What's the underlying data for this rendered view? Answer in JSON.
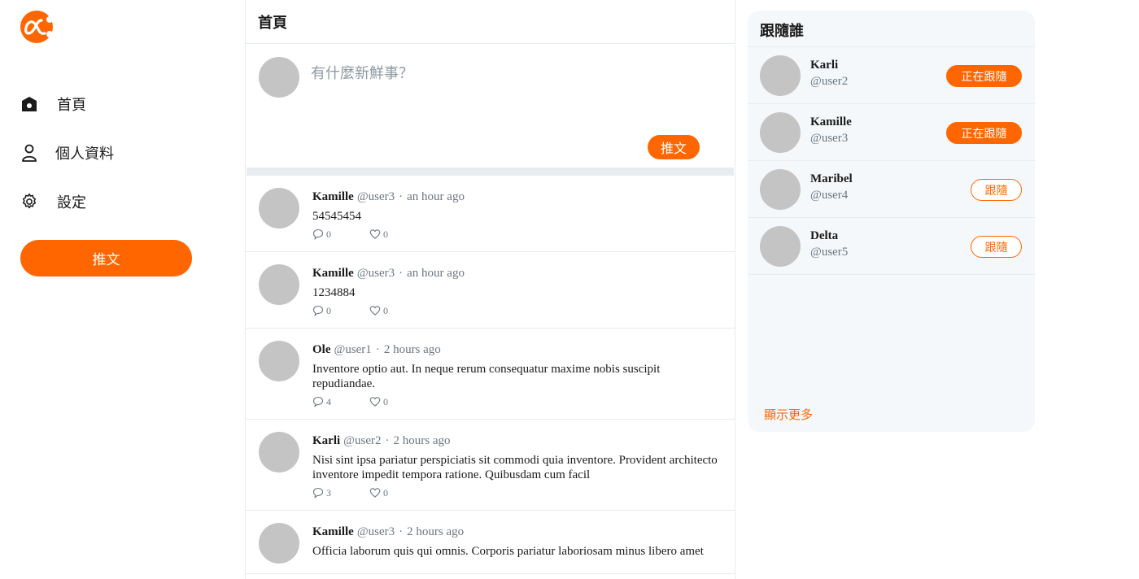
{
  "app": {
    "brand_color": "#ff6600",
    "logo_icon": "alpha-logo-icon"
  },
  "sidebar": {
    "items": [
      {
        "label": "首頁",
        "icon": "home-icon"
      },
      {
        "label": "個人資料",
        "icon": "user-icon"
      },
      {
        "label": "設定",
        "icon": "gear-icon"
      }
    ],
    "tweet_button": "推文"
  },
  "main": {
    "title": "首頁",
    "composer": {
      "placeholder": "有什麼新鮮事？",
      "tweet_button": "推文"
    },
    "tweets": [
      {
        "name": "Kamille",
        "handle": "@user3",
        "time": "an hour ago",
        "text": "54545454",
        "replies": "0",
        "likes": "0"
      },
      {
        "name": "Kamille",
        "handle": "@user3",
        "time": "an hour ago",
        "text": "1234884",
        "replies": "0",
        "likes": "0"
      },
      {
        "name": "Ole",
        "handle": "@user1",
        "time": "2 hours ago",
        "text": "Inventore optio aut. In neque rerum consequatur maxime nobis suscipit repudiandae.",
        "replies": "4",
        "likes": "0"
      },
      {
        "name": "Karli",
        "handle": "@user2",
        "time": "2 hours ago",
        "text": "Nisi sint ipsa pariatur perspiciatis sit commodi quia inventore. Provident architecto inventore impedit tempora ratione. Quibusdam cum facil",
        "replies": "3",
        "likes": "0"
      },
      {
        "name": "Kamille",
        "handle": "@user3",
        "time": "2 hours ago",
        "text": "Officia laborum quis qui omnis. Corporis pariatur laboriosam minus libero amet",
        "replies": "",
        "likes": ""
      }
    ]
  },
  "who_to_follow": {
    "title": "跟隨誰",
    "users": [
      {
        "name": "Karli",
        "handle": "@user2",
        "button": "正在跟隨",
        "following": true
      },
      {
        "name": "Kamille",
        "handle": "@user3",
        "button": "正在跟隨",
        "following": true
      },
      {
        "name": "Maribel",
        "handle": "@user4",
        "button": "跟隨",
        "following": false
      },
      {
        "name": "Delta",
        "handle": "@user5",
        "button": "跟隨",
        "following": false
      }
    ],
    "show_more": "顯示更多"
  }
}
